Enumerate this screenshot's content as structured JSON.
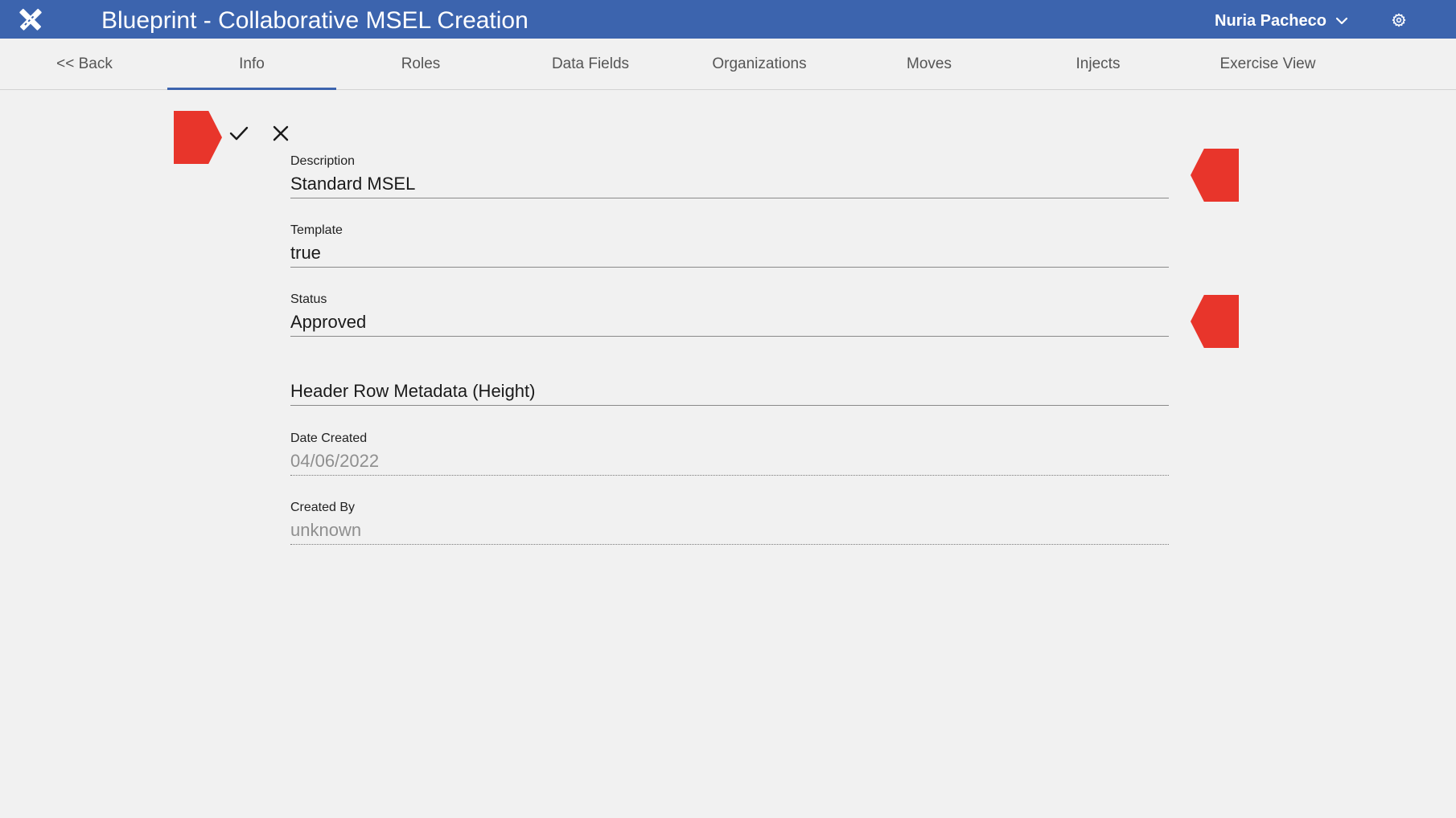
{
  "header": {
    "logo_icon": "pencil-ruler-icon",
    "title": "Blueprint - Collaborative MSEL Creation",
    "user_name": "Nuria Pacheco",
    "user_menu_icon": "chevron-down-icon",
    "settings_icon": "gear-icon",
    "bar_color": "#3c64ae"
  },
  "tabs": [
    {
      "label": "<< Back",
      "active": false
    },
    {
      "label": "Info",
      "active": true
    },
    {
      "label": "Roles",
      "active": false
    },
    {
      "label": "Data Fields",
      "active": false
    },
    {
      "label": "Organizations",
      "active": false
    },
    {
      "label": "Moves",
      "active": false
    },
    {
      "label": "Injects",
      "active": false
    },
    {
      "label": "Exercise View",
      "active": false
    }
  ],
  "actions": {
    "save_icon": "check-icon",
    "cancel_icon": "close-icon"
  },
  "form": {
    "description": {
      "label": "Description",
      "value": "Standard MSEL"
    },
    "template": {
      "label": "Template",
      "value": "true"
    },
    "status": {
      "label": "Status",
      "value": "Approved"
    },
    "header_row_metadata": {
      "label": "",
      "value": "Header Row Metadata (Height)"
    },
    "date_created": {
      "label": "Date Created",
      "value": "04/06/2022"
    },
    "created_by": {
      "label": "Created By",
      "value": "unknown"
    }
  },
  "colors": {
    "accent": "#3c64ae",
    "marker": "#e8352b",
    "background": "#f1f1f1"
  }
}
